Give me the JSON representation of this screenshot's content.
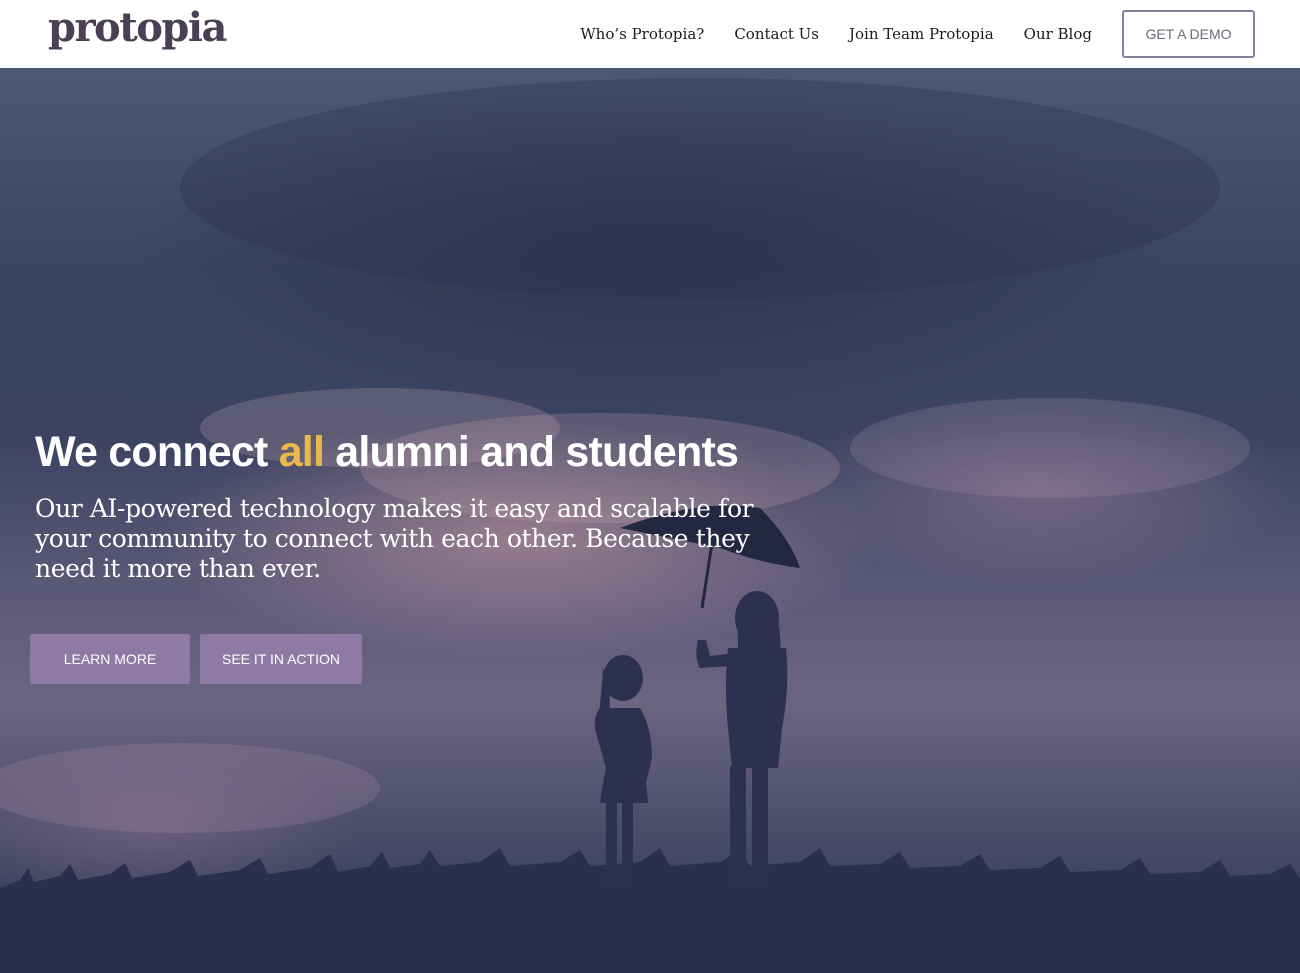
{
  "brand": {
    "logo_text": "protopia",
    "logo_color": "#4a3f55"
  },
  "nav": {
    "items": [
      {
        "label": "Who’s Protopia?"
      },
      {
        "label": "Contact Us"
      },
      {
        "label": "Join Team Protopia"
      },
      {
        "label": "Our Blog"
      }
    ],
    "demo_button": "GET A DEMO"
  },
  "hero": {
    "headline_before": "We connect ",
    "headline_highlight": "all",
    "headline_after": " alumni and students",
    "subtext": "Our AI-powered technology makes it easy and scalable for your community to connect with each other. Because they need it more than ever.",
    "buttons": {
      "learn_more": "LEARN MORE",
      "see_in_action": "SEE IT IN ACTION"
    },
    "image_description_icon": "silhouette-umbrella-image"
  },
  "colors": {
    "accent_highlight": "#e8b84a",
    "button_purple": "#8f7aa6",
    "demo_border": "#8a7f9a"
  }
}
